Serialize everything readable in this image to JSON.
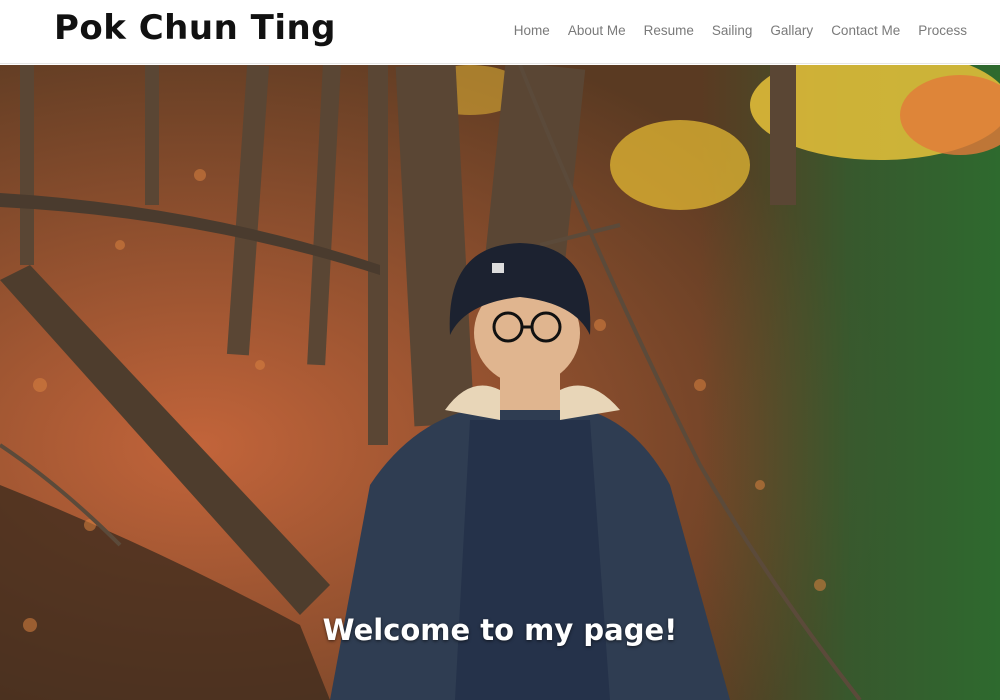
{
  "site": {
    "title": "Pok Chun Ting"
  },
  "nav": {
    "items": [
      {
        "label": "Home"
      },
      {
        "label": "About Me"
      },
      {
        "label": "Resume"
      },
      {
        "label": "Sailing"
      },
      {
        "label": "Gallary"
      },
      {
        "label": "Contact Me"
      },
      {
        "label": "Process"
      }
    ]
  },
  "hero": {
    "welcome_text": "Welcome to my page!",
    "colors": {
      "leaves": "#b5562a",
      "foliage_yellow": "#e8c23a",
      "foliage_green": "#3f7d3a",
      "trunk": "#5a4634",
      "jacket": "#2f3d52",
      "shirt": "#25324a",
      "hat": "#1c2230",
      "skin": "#e0b58f"
    }
  }
}
